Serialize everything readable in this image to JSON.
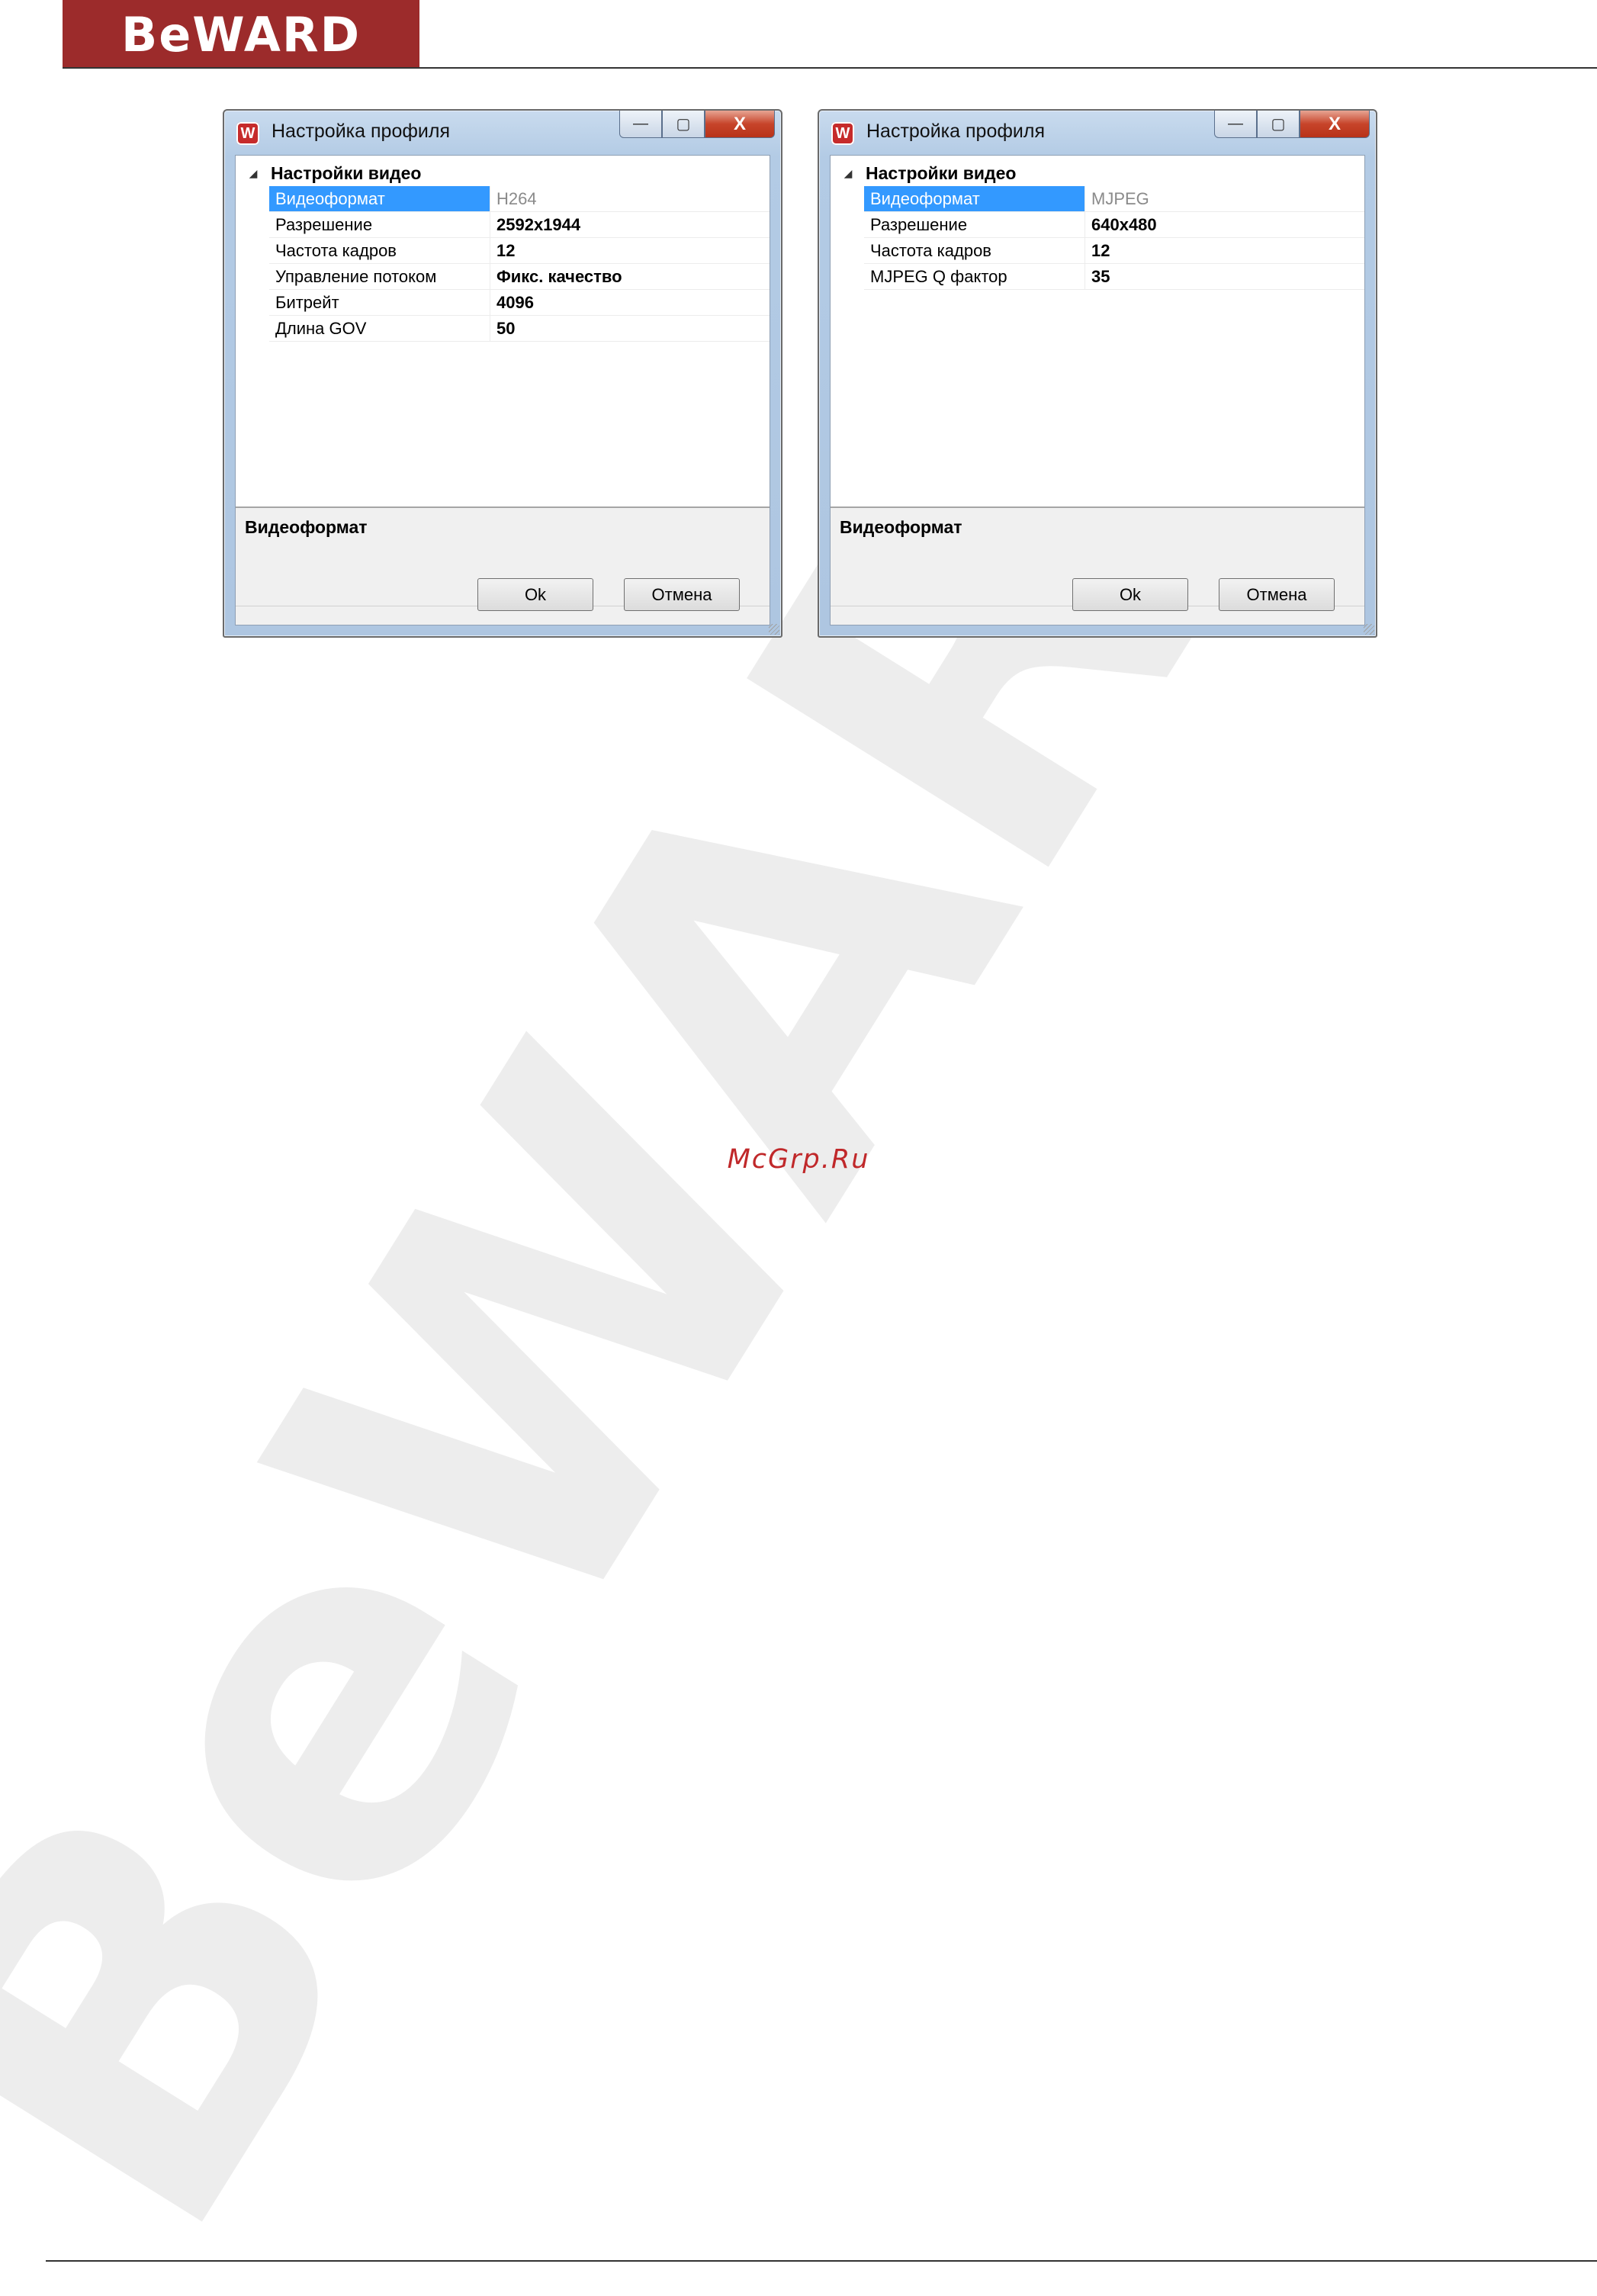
{
  "header": {
    "logo_text": "BeWARD"
  },
  "watermark": {
    "text": "BeWARD"
  },
  "site_link": "McGrp.Ru",
  "dialogs": [
    {
      "title": "Настройка профиля",
      "buttons": {
        "minimize": "—",
        "maximize": "▢",
        "close": "X"
      },
      "category": "Настройки видео",
      "properties": [
        {
          "name": "Видеоформат",
          "value": "H264"
        },
        {
          "name": "Разрешение",
          "value": "2592x1944"
        },
        {
          "name": "Частота кадров",
          "value": "12"
        },
        {
          "name": "Управление потоком",
          "value": "Фикс. качество"
        },
        {
          "name": "Битрейт",
          "value": "4096"
        },
        {
          "name": "Длина GOV",
          "value": "50"
        }
      ],
      "description_title": "Видеоформат",
      "ok_label": "Ok",
      "cancel_label": "Отмена"
    },
    {
      "title": "Настройка профиля",
      "buttons": {
        "minimize": "—",
        "maximize": "▢",
        "close": "X"
      },
      "category": "Настройки видео",
      "properties": [
        {
          "name": "Видеоформат",
          "value": "MJPEG"
        },
        {
          "name": "Разрешение",
          "value": "640x480"
        },
        {
          "name": "Частота кадров",
          "value": "12"
        },
        {
          "name": "MJPEG Q фактор",
          "value": "35"
        }
      ],
      "description_title": "Видеоформат",
      "ok_label": "Ok",
      "cancel_label": "Отмена"
    }
  ]
}
